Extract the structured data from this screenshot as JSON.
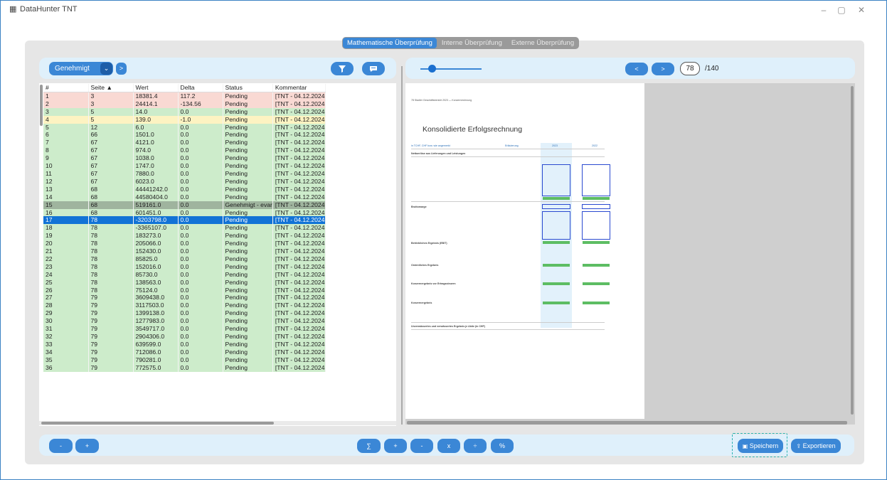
{
  "app": {
    "title": "DataHunter TNT",
    "window_controls": [
      "–",
      "▢",
      "✕"
    ]
  },
  "tabs": [
    {
      "label": "Mathematische Überprüfung",
      "active": true
    },
    {
      "label": "Interne Überprüfung",
      "active": false
    },
    {
      "label": "Externe Überprüfung",
      "active": false
    }
  ],
  "toolbar_left": {
    "status_filter": "Genehmigt",
    "dropdown_icon": "chevron-down-icon",
    "next_label": ">"
  },
  "table": {
    "columns": [
      "#",
      "Seite ▲",
      "Wert",
      "Delta",
      "Status",
      "Kommentar"
    ],
    "rows": [
      {
        "n": "1",
        "seite": "3",
        "wert": "18381.4",
        "delta": "117.2",
        "status": "Pending",
        "kommentar": "[TNT - 04.12.2024",
        "color": "red"
      },
      {
        "n": "2",
        "seite": "3",
        "wert": "24414.1",
        "delta": "-134.56",
        "status": "Pending",
        "kommentar": "[TNT - 04.12.2024",
        "color": "red"
      },
      {
        "n": "3",
        "seite": "5",
        "wert": "14.0",
        "delta": "0.0",
        "status": "Pending",
        "kommentar": "[TNT - 04.12.2024",
        "color": "green"
      },
      {
        "n": "4",
        "seite": "5",
        "wert": "139.0",
        "delta": "-1.0",
        "status": "Pending",
        "kommentar": "[TNT - 04.12.2024",
        "color": "yellow"
      },
      {
        "n": "5",
        "seite": "12",
        "wert": "6.0",
        "delta": "0.0",
        "status": "Pending",
        "kommentar": "[TNT - 04.12.2024",
        "color": "green"
      },
      {
        "n": "6",
        "seite": "66",
        "wert": "1501.0",
        "delta": "0.0",
        "status": "Pending",
        "kommentar": "[TNT - 04.12.2024",
        "color": "green"
      },
      {
        "n": "7",
        "seite": "67",
        "wert": "4121.0",
        "delta": "0.0",
        "status": "Pending",
        "kommentar": "[TNT - 04.12.2024",
        "color": "green"
      },
      {
        "n": "8",
        "seite": "67",
        "wert": "974.0",
        "delta": "0.0",
        "status": "Pending",
        "kommentar": "[TNT - 04.12.2024",
        "color": "green"
      },
      {
        "n": "9",
        "seite": "67",
        "wert": "1038.0",
        "delta": "0.0",
        "status": "Pending",
        "kommentar": "[TNT - 04.12.2024",
        "color": "green"
      },
      {
        "n": "10",
        "seite": "67",
        "wert": "1747.0",
        "delta": "0.0",
        "status": "Pending",
        "kommentar": "[TNT - 04.12.2024",
        "color": "green"
      },
      {
        "n": "11",
        "seite": "67",
        "wert": "7880.0",
        "delta": "0.0",
        "status": "Pending",
        "kommentar": "[TNT - 04.12.2024",
        "color": "green"
      },
      {
        "n": "12",
        "seite": "67",
        "wert": "6023.0",
        "delta": "0.0",
        "status": "Pending",
        "kommentar": "[TNT - 04.12.2024",
        "color": "green"
      },
      {
        "n": "13",
        "seite": "68",
        "wert": "44441242.0",
        "delta": "0.0",
        "status": "Pending",
        "kommentar": "[TNT - 04.12.2024",
        "color": "green"
      },
      {
        "n": "14",
        "seite": "68",
        "wert": "44580404.0",
        "delta": "0.0",
        "status": "Pending",
        "kommentar": "[TNT - 04.12.2024",
        "color": "green"
      },
      {
        "n": "15",
        "seite": "68",
        "wert": "519161.0",
        "delta": "0.0",
        "status": "Genehmigt - evar",
        "kommentar": "[TNT - 04.12.2024",
        "color": "dark"
      },
      {
        "n": "16",
        "seite": "68",
        "wert": "601451.0",
        "delta": "0.0",
        "status": "Pending",
        "kommentar": "[TNT - 04.12.2024",
        "color": "green"
      },
      {
        "n": "17",
        "seite": "78",
        "wert": "-3203798.0",
        "delta": "0.0",
        "status": "Pending",
        "kommentar": "[TNT - 04.12.2024",
        "color": "sel"
      },
      {
        "n": "18",
        "seite": "78",
        "wert": "-3365107.0",
        "delta": "0.0",
        "status": "Pending",
        "kommentar": "[TNT - 04.12.2024",
        "color": "green"
      },
      {
        "n": "19",
        "seite": "78",
        "wert": "183273.0",
        "delta": "0.0",
        "status": "Pending",
        "kommentar": "[TNT - 04.12.2024",
        "color": "green"
      },
      {
        "n": "20",
        "seite": "78",
        "wert": "205066.0",
        "delta": "0.0",
        "status": "Pending",
        "kommentar": "[TNT - 04.12.2024",
        "color": "green"
      },
      {
        "n": "21",
        "seite": "78",
        "wert": "152430.0",
        "delta": "0.0",
        "status": "Pending",
        "kommentar": "[TNT - 04.12.2024",
        "color": "green"
      },
      {
        "n": "22",
        "seite": "78",
        "wert": "85825.0",
        "delta": "0.0",
        "status": "Pending",
        "kommentar": "[TNT - 04.12.2024",
        "color": "green"
      },
      {
        "n": "23",
        "seite": "78",
        "wert": "152016.0",
        "delta": "0.0",
        "status": "Pending",
        "kommentar": "[TNT - 04.12.2024",
        "color": "green"
      },
      {
        "n": "24",
        "seite": "78",
        "wert": "85730.0",
        "delta": "0.0",
        "status": "Pending",
        "kommentar": "[TNT - 04.12.2024",
        "color": "green"
      },
      {
        "n": "25",
        "seite": "78",
        "wert": "138563.0",
        "delta": "0.0",
        "status": "Pending",
        "kommentar": "[TNT - 04.12.2024",
        "color": "green"
      },
      {
        "n": "26",
        "seite": "78",
        "wert": "75124.0",
        "delta": "0.0",
        "status": "Pending",
        "kommentar": "[TNT - 04.12.2024",
        "color": "green"
      },
      {
        "n": "27",
        "seite": "79",
        "wert": "3609438.0",
        "delta": "0.0",
        "status": "Pending",
        "kommentar": "[TNT - 04.12.2024",
        "color": "green"
      },
      {
        "n": "28",
        "seite": "79",
        "wert": "3117503.0",
        "delta": "0.0",
        "status": "Pending",
        "kommentar": "[TNT - 04.12.2024",
        "color": "green"
      },
      {
        "n": "29",
        "seite": "79",
        "wert": "1399138.0",
        "delta": "0.0",
        "status": "Pending",
        "kommentar": "[TNT - 04.12.2024",
        "color": "green"
      },
      {
        "n": "30",
        "seite": "79",
        "wert": "1277983.0",
        "delta": "0.0",
        "status": "Pending",
        "kommentar": "[TNT - 04.12.2024",
        "color": "green"
      },
      {
        "n": "31",
        "seite": "79",
        "wert": "3549717.0",
        "delta": "0.0",
        "status": "Pending",
        "kommentar": "[TNT - 04.12.2024",
        "color": "green"
      },
      {
        "n": "32",
        "seite": "79",
        "wert": "2904306.0",
        "delta": "0.0",
        "status": "Pending",
        "kommentar": "[TNT - 04.12.2024",
        "color": "green"
      },
      {
        "n": "33",
        "seite": "79",
        "wert": "639599.0",
        "delta": "0.0",
        "status": "Pending",
        "kommentar": "[TNT - 04.12.2024",
        "color": "green"
      },
      {
        "n": "34",
        "seite": "79",
        "wert": "712086.0",
        "delta": "0.0",
        "status": "Pending",
        "kommentar": "[TNT - 04.12.2024",
        "color": "green"
      },
      {
        "n": "35",
        "seite": "79",
        "wert": "790281.0",
        "delta": "0.0",
        "status": "Pending",
        "kommentar": "[TNT - 04.12.2024",
        "color": "green"
      },
      {
        "n": "36",
        "seite": "79",
        "wert": "772575.0",
        "delta": "0.0",
        "status": "Pending",
        "kommentar": "[TNT - 04.12.2024",
        "color": "green"
      }
    ]
  },
  "viewer": {
    "prev_label": "<",
    "next_label": ">",
    "page_current": "78",
    "page_total": "/140"
  },
  "document": {
    "header": "78  Stadler Geschäftsbericht 2023  —  Konzernrechnung",
    "title": "Konsolidierte Erfolgsrechnung",
    "col_header": "in TCHF, CHF bzw. wie angemerkt",
    "col_note": "Erläuterung",
    "year1": "2023",
    "year2": "2022",
    "line1": "Nettoerlöse aus Lieferungen und Leistungen",
    "line2": "Bruttomarge",
    "line3": "Betriebliches Ergebnis (EBIT)",
    "line4": "Ordentliches Ergebnis",
    "line5": "Konzernergebnis vor Ertragssteuern",
    "line6": "Konzernergebnis",
    "line7": "Unverwässertes und verwässertes Ergebnis je Aktie (in CHF)"
  },
  "bottom_left": {
    "minus_label": "-",
    "plus_label": "+"
  },
  "bottom_center": [
    "∑",
    "+",
    "-",
    "x",
    "÷",
    "%"
  ],
  "bottom_right": {
    "save_label": "Speichern",
    "export_label": "Exportieren"
  },
  "colors": {
    "accent": "#3b87d6",
    "selected": "#1273d6",
    "row_ok": "#cdeccb",
    "row_error": "#f9d9d3",
    "row_warn": "#fdf3c2"
  }
}
